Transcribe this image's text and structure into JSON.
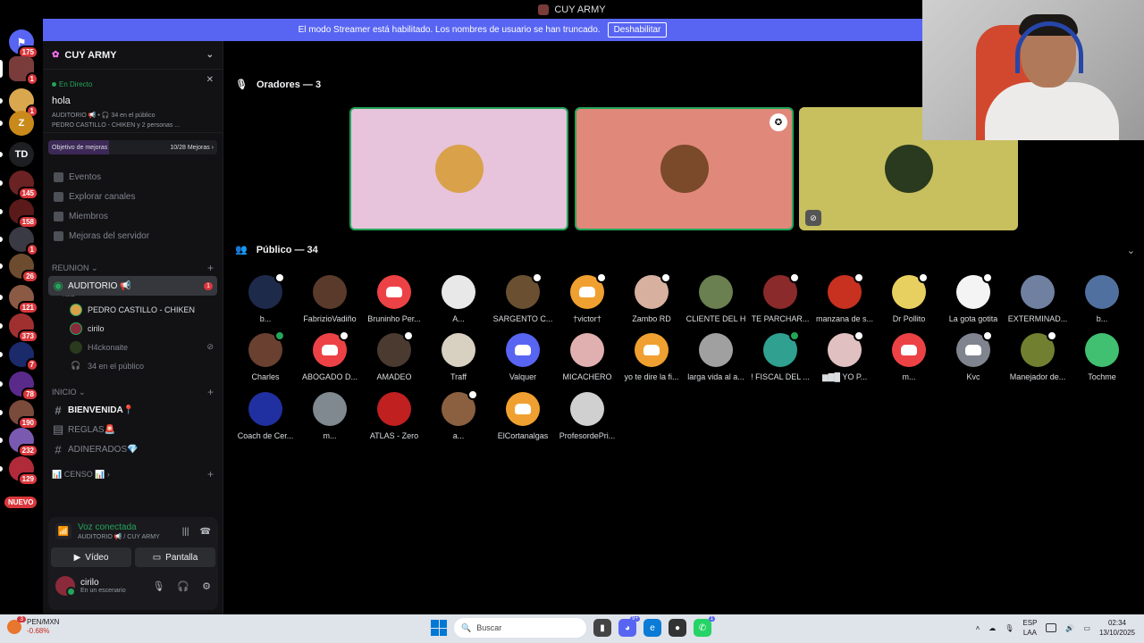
{
  "window": {
    "title": "CUY ARMY"
  },
  "streamer_banner": {
    "text": "El modo Streamer está habilitado. Los nombres de usuario se han truncado.",
    "button": "Deshabilitar"
  },
  "guilds": [
    {
      "badge": "175",
      "color": "#5865f2",
      "glyph": "⚑"
    },
    {
      "badge": "1",
      "color": "#7a3b3b",
      "glyph": ""
    },
    {
      "badge": "1",
      "color": "#d9a84e",
      "glyph": ""
    },
    {
      "badge": "",
      "color": "#c98a1b",
      "glyph": "Z"
    },
    {
      "badge": "",
      "color": "#1e1f22",
      "glyph": "TD"
    },
    {
      "badge": "145",
      "color": "#6b2222",
      "glyph": ""
    },
    {
      "badge": "158",
      "color": "#5a1a1a",
      "glyph": ""
    },
    {
      "badge": "1",
      "color": "#3a3a44",
      "glyph": ""
    },
    {
      "badge": "26",
      "color": "#6d4b2e",
      "glyph": ""
    },
    {
      "badge": "121",
      "color": "#8a5a44",
      "glyph": ""
    },
    {
      "badge": "373",
      "color": "#a03030",
      "glyph": ""
    },
    {
      "badge": "7",
      "color": "#1b2a6b",
      "glyph": ""
    },
    {
      "badge": "78",
      "color": "#5a2a8a",
      "glyph": ""
    },
    {
      "badge": "190",
      "color": "#7a4a3a",
      "glyph": ""
    },
    {
      "badge": "232",
      "color": "#7a5ab0",
      "glyph": ""
    },
    {
      "badge": "129",
      "color": "#b02a3a",
      "glyph": ""
    }
  ],
  "new_label": "NUEVO",
  "server": {
    "name": "CUY ARMY"
  },
  "live": {
    "status": "En Directo",
    "title": "hola",
    "channel_line": "AUDITORIO 📢 • 🎧 34 en el público",
    "people_line": "PEDRO CASTILLO - CHIKEN y 2 personas ..."
  },
  "boost": {
    "label": "Objetivo de mejoras",
    "progress": "10/28 Mejoras ›"
  },
  "nav": [
    "Eventos",
    "Explorar canales",
    "Miembros",
    "Mejoras del servidor"
  ],
  "categories": {
    "reunion": "REUNION ⌄",
    "inicio": "INICIO ⌄",
    "censo": "📊 CENSO 📊 ›"
  },
  "voice_channel": {
    "name": "AUDITORIO 📢",
    "topic": "hola",
    "badge": "1",
    "users": [
      "PEDRO CASTILLO - CHIKEN",
      "cirilo",
      "H4ckonaite"
    ],
    "audience": "34 en el público"
  },
  "text_channels": [
    "BIENVENIDA📍",
    "REGLAS🚨",
    "ADINERADOS💎"
  ],
  "voice_panel": {
    "status": "Voz conectada",
    "location": "AUDITORIO 📢 / CUY ARMY",
    "video": "Vídeo",
    "screen": "Pantalla"
  },
  "user": {
    "name": "cirilo",
    "status": "En un escenario"
  },
  "speakers_title": "Oradores — 3",
  "audience_title": "Público — 34",
  "speakers": [
    {
      "bg": "#e8c3dc",
      "avatar": "#d9a24a"
    },
    {
      "bg": "#e0887a",
      "avatar": "#7a4a2a"
    },
    {
      "bg": "#c8bf5e",
      "avatar": "#2a3a1e"
    }
  ],
  "audience": [
    {
      "name": "b...",
      "color": "#1e2a4a",
      "mark": "w"
    },
    {
      "name": "FabrizioVadiño",
      "color": "#5a3a2a",
      "mark": ""
    },
    {
      "name": "Bruninho Per...",
      "color": "#ed4245",
      "mark": "",
      "dc": true
    },
    {
      "name": "A...",
      "color": "#e8e8e8",
      "mark": ""
    },
    {
      "name": "SARGENTO C...",
      "color": "#6a5030",
      "mark": "w"
    },
    {
      "name": "†victor†",
      "color": "#f0a030",
      "mark": "w",
      "dc": true
    },
    {
      "name": "Zambo RD",
      "color": "#d8b0a0",
      "mark": "w"
    },
    {
      "name": "CLIENTE DEL H",
      "color": "#6a8050",
      "mark": ""
    },
    {
      "name": "TE PARCHAR...",
      "color": "#8a2a2a",
      "mark": "w"
    },
    {
      "name": "manzana de s...",
      "color": "#c83020",
      "mark": "w"
    },
    {
      "name": "Dr Pollito",
      "color": "#e8d060",
      "mark": "w"
    },
    {
      "name": "La gota gotita",
      "color": "#f4f4f4",
      "mark": "w"
    },
    {
      "name": "EXTERMINAD...",
      "color": "#7080a0",
      "mark": ""
    },
    {
      "name": "b...",
      "color": "#5070a0",
      "mark": ""
    },
    {
      "name": "Charles",
      "color": "#6a4030",
      "mark": "g"
    },
    {
      "name": "ABOGADO D...",
      "color": "#ed4245",
      "mark": "w",
      "dc": true
    },
    {
      "name": "AMADEO",
      "color": "#4a3a30",
      "mark": "w"
    },
    {
      "name": "Traff",
      "color": "#d8d0c0",
      "mark": ""
    },
    {
      "name": "Valquer",
      "color": "#5865f2",
      "mark": "",
      "dc": true
    },
    {
      "name": "MICACHERO",
      "color": "#e0b0b0",
      "mark": ""
    },
    {
      "name": "yo te dire la fi...",
      "color": "#f0a030",
      "mark": "",
      "dc": true
    },
    {
      "name": "larga vida al a...",
      "color": "#a0a0a0",
      "mark": ""
    },
    {
      "name": "! FISCAL DEL ...",
      "color": "#30a090",
      "mark": "g"
    },
    {
      "name": "▆▇█ YO P...",
      "color": "#e0c0c0",
      "mark": "w"
    },
    {
      "name": "m...",
      "color": "#ed4245",
      "mark": "",
      "dc": true
    },
    {
      "name": "Kvc",
      "color": "#80848e",
      "mark": "w",
      "dc": true
    },
    {
      "name": "Manejador de...",
      "color": "#708030",
      "mark": "w"
    },
    {
      "name": "Tochme",
      "color": "#40c070",
      "mark": ""
    },
    {
      "name": "Coach de Cer...",
      "color": "#2030a0",
      "mark": ""
    },
    {
      "name": "m...",
      "color": "#808890",
      "mark": ""
    },
    {
      "name": "ATLAS - Zero",
      "color": "#c02020",
      "mark": ""
    },
    {
      "name": "a...",
      "color": "#8a6040",
      "mark": "w"
    },
    {
      "name": "ElCortanalgas",
      "color": "#f0a030",
      "mark": "",
      "dc": true
    },
    {
      "name": "ProfesordePri...",
      "color": "#d0d0d0",
      "mark": ""
    }
  ],
  "taskbar": {
    "ticker": "PEN/MXN",
    "change": "-0.68%",
    "ticker_badge": "3",
    "search": "Buscar",
    "lang1": "ESP",
    "lang2": "LAA",
    "time": "02:34",
    "date": "13/10/2025"
  }
}
